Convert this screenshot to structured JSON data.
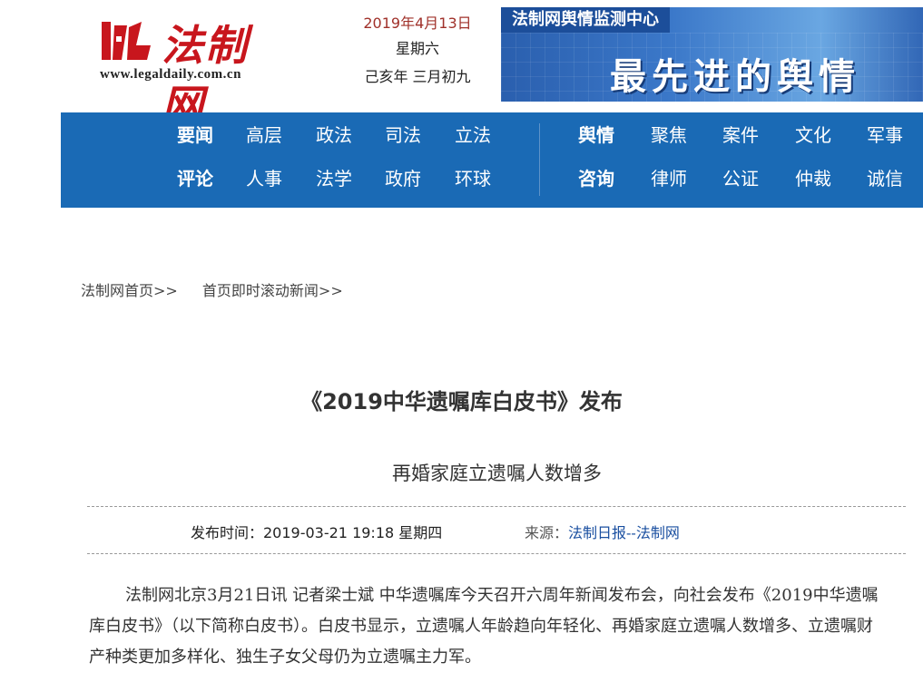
{
  "header": {
    "logo_text": "法制网",
    "logo_url": "www.legaldaily.com.cn",
    "date": "2019年4月13日",
    "weekday": "星期六",
    "lunar": "己亥年 三月初九",
    "banner_title": "法制网舆情监测中心",
    "banner_slogan": "最先进的舆情"
  },
  "nav": {
    "row1_left": [
      "要闻",
      "高层",
      "政法",
      "司法",
      "立法"
    ],
    "row2_left": [
      "评论",
      "人事",
      "法学",
      "政府",
      "环球"
    ],
    "row1_right": [
      "舆情",
      "聚焦",
      "案件",
      "文化",
      "军事"
    ],
    "row2_right": [
      "咨询",
      "律师",
      "公证",
      "仲裁",
      "诚信"
    ]
  },
  "breadcrumb": [
    "法制网首页>>",
    "首页即时滚动新闻>>"
  ],
  "article": {
    "title": "《2019中华遗嘱库白皮书》发布",
    "subtitle": "再婚家庭立遗嘱人数增多",
    "publish_time": "发布时间：2019-03-21 19:18 星期四",
    "source_label": "来源：",
    "source_link": "法制日报--法制网",
    "body": "法制网北京3月21日讯  记者梁士斌  中华遗嘱库今天召开六周年新闻发布会，向社会发布《2019中华遗嘱库白皮书》（以下简称白皮书）。白皮书显示，立遗嘱人年龄趋向年轻化、再婚家庭立遗嘱人数增多、立遗嘱财产种类更加多样化、独生子女父母仍为立遗嘱主力军。"
  },
  "colors": {
    "nav_bg": "#1a6ab5",
    "logo_red": "#c8161d",
    "date_red": "#a0312a",
    "link_blue": "#1a4fa0"
  }
}
